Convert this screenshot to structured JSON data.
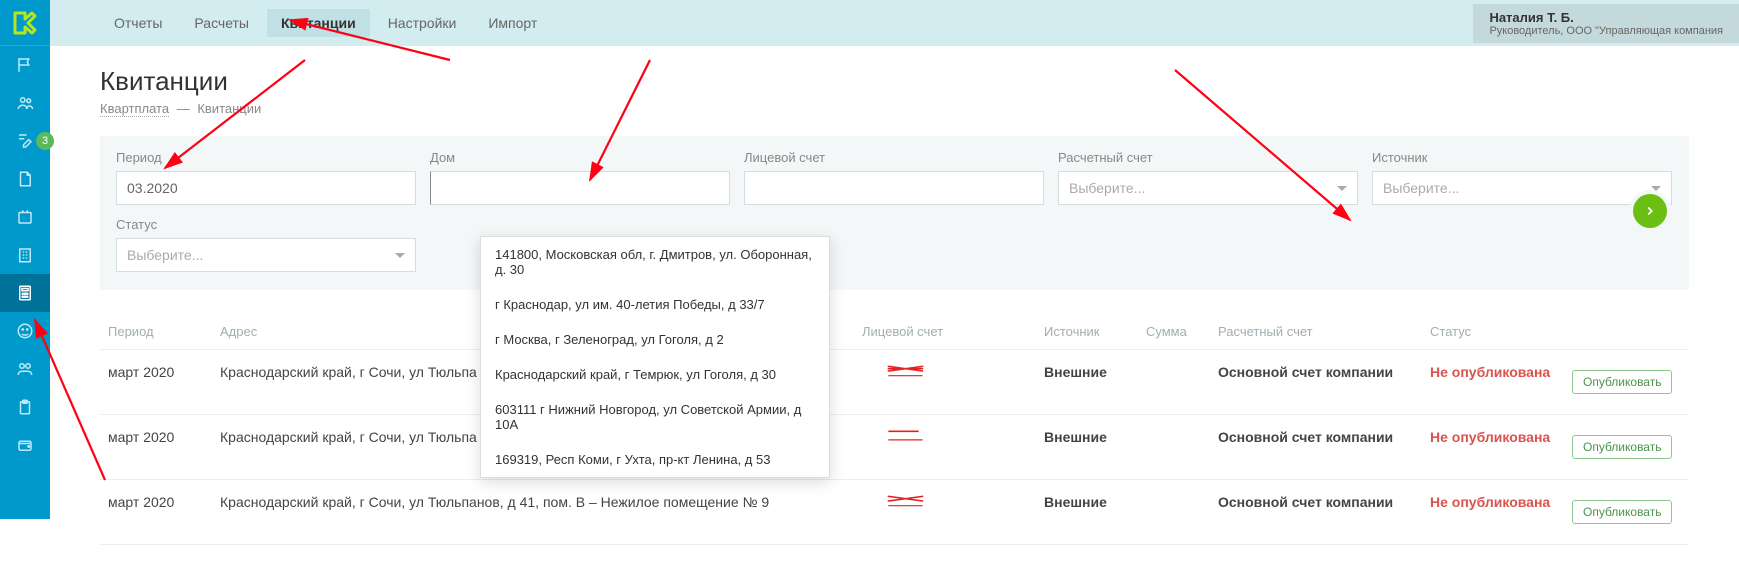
{
  "user": {
    "name": "Наталия Т. Б.",
    "role": "Руководитель, ООО \"Управляющая компания"
  },
  "sidebar": {
    "items": [
      {
        "name": "flag-icon"
      },
      {
        "name": "users-icon"
      },
      {
        "name": "edit-icon",
        "badge": "3"
      },
      {
        "name": "file-icon"
      },
      {
        "name": "survey-icon"
      },
      {
        "name": "building-icon"
      },
      {
        "name": "calculator-icon",
        "active": true
      },
      {
        "name": "smiley-icon"
      },
      {
        "name": "group-icon"
      },
      {
        "name": "clipboard-icon"
      },
      {
        "name": "wallet-icon"
      }
    ]
  },
  "topnav": {
    "items": [
      {
        "label": "Отчеты"
      },
      {
        "label": "Расчеты"
      },
      {
        "label": "Квитанции",
        "active": true
      },
      {
        "label": "Настройки"
      },
      {
        "label": "Импорт"
      }
    ]
  },
  "page": {
    "title": "Квитанции",
    "breadcrumb_root": "Квартплата",
    "breadcrumb_current": "Квитанции"
  },
  "filters": {
    "period": {
      "label": "Период",
      "value": "03.2020"
    },
    "house": {
      "label": "Дом",
      "value": ""
    },
    "account": {
      "label": "Лицевой счет",
      "value": ""
    },
    "bank": {
      "label": "Расчетный счет",
      "placeholder": "Выберите..."
    },
    "source": {
      "label": "Источник",
      "placeholder": "Выберите..."
    },
    "status": {
      "label": "Статус",
      "placeholder": "Выберите..."
    }
  },
  "house_dropdown": [
    "141800, Московская обл, г. Дмитров, ул. Оборонная, д. 30",
    "г Краснодар, ул им. 40-летия Победы, д 33/7",
    "г Москва, г Зеленоград, ул Гоголя, д 2",
    "Краснодарский край, г Темрюк, ул Гоголя, д 30",
    "603111 г Нижний Новгород, ул Советской Армии, д 10А",
    "169319, Респ Коми, г Ухта, пр-кт Ленина, д 53"
  ],
  "table": {
    "headers": {
      "period": "Период",
      "address": "Адрес",
      "account": "Лицевой счет",
      "source": "Источник",
      "sum": "Сумма",
      "bank": "Расчетный счет",
      "status": "Статус"
    },
    "rows": [
      {
        "period": "март 2020",
        "address": "Краснодарский край, г Сочи, ул Тюльпа",
        "source": "Внешние",
        "sum": "",
        "bank": "Основной счет компании",
        "status": "Не опубликована",
        "action": "Опубликовать"
      },
      {
        "period": "март 2020",
        "address": "Краснодарский край, г Сочи, ул Тюльпа",
        "source": "Внешние",
        "sum": "",
        "bank": "Основной счет компании",
        "status": "Не опубликована",
        "action": "Опубликовать"
      },
      {
        "period": "март 2020",
        "address": "Краснодарский край, г Сочи, ул Тюльпанов, д 41, пом. B – Нежилое помещение № 9",
        "source": "Внешние",
        "sum": "",
        "bank": "Основной счет компании",
        "status": "Не опубликована",
        "action": "Опубликовать"
      }
    ]
  }
}
